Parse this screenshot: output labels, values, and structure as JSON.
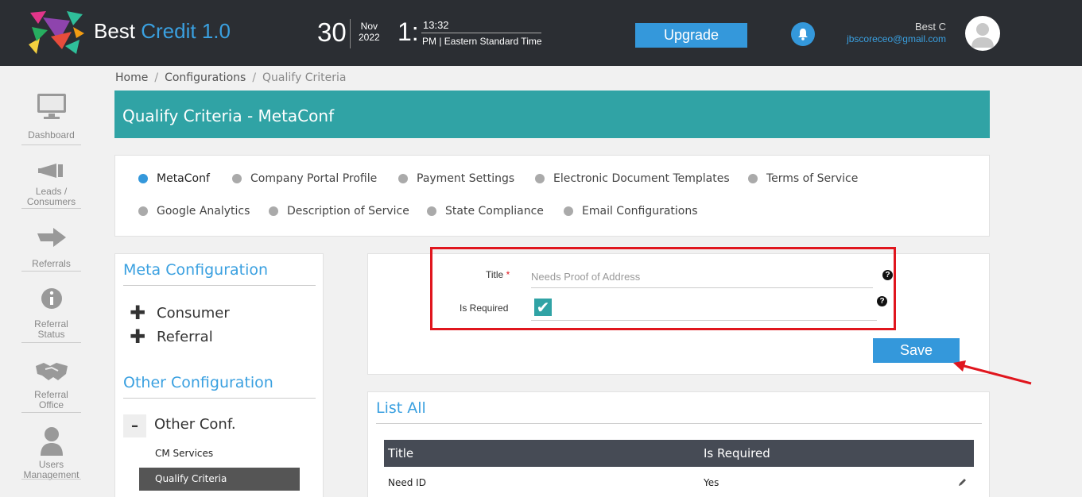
{
  "header": {
    "brand_prefix": "Best ",
    "brand_highlight": "Credit 1.0",
    "day": "30",
    "month": "Nov",
    "year": "2022",
    "hour": "1:",
    "minute": "13:32",
    "ampm": "PM",
    "timezone": "Eastern Standard Time",
    "upgrade_label": "Upgrade",
    "user_name": "Best C",
    "user_email": "jbscoreceo@gmail.com"
  },
  "sidebar": {
    "items": [
      {
        "label_line1": "Dashboard",
        "label_line2": ""
      },
      {
        "label_line1": "Leads /",
        "label_line2": "Consumers"
      },
      {
        "label_line1": "Referrals",
        "label_line2": ""
      },
      {
        "label_line1": "Referral",
        "label_line2": "Status"
      },
      {
        "label_line1": "Referral",
        "label_line2": "Office"
      },
      {
        "label_line1": "Users",
        "label_line2": "Management"
      }
    ]
  },
  "breadcrumb": {
    "home": "Home",
    "configurations": "Configurations",
    "current": "Qualify Criteria"
  },
  "page_title": "Qualify Criteria - MetaConf",
  "tabs": [
    "MetaConf",
    "Company Portal Profile",
    "Payment Settings",
    "Electronic Document Templates",
    "Terms of Service",
    "Google Analytics",
    "Description of Service",
    "State Compliance",
    "Email Configurations"
  ],
  "config": {
    "meta_heading": "Meta Configuration",
    "meta_items": [
      "Consumer",
      "Referral"
    ],
    "other_heading": "Other Configuration",
    "other_group": "Other Conf.",
    "other_minus": "–",
    "other_subitems": [
      "CM Services",
      "Qualify Criteria"
    ]
  },
  "form": {
    "title_label": "Title",
    "required_marker": "*",
    "title_placeholder": "Needs Proof of Address",
    "is_required_label": "Is Required",
    "is_required_checked": true,
    "help_glyph": "?",
    "save_label": "Save"
  },
  "list": {
    "heading": "List All",
    "columns": [
      "Title",
      "Is Required"
    ],
    "rows": [
      {
        "title": "Need ID",
        "is_required": "Yes"
      }
    ]
  },
  "colors": {
    "header_bg": "#2b2e33",
    "accent_teal": "#30a3a5",
    "accent_blue": "#3498db",
    "highlight_red": "#e0161e"
  }
}
